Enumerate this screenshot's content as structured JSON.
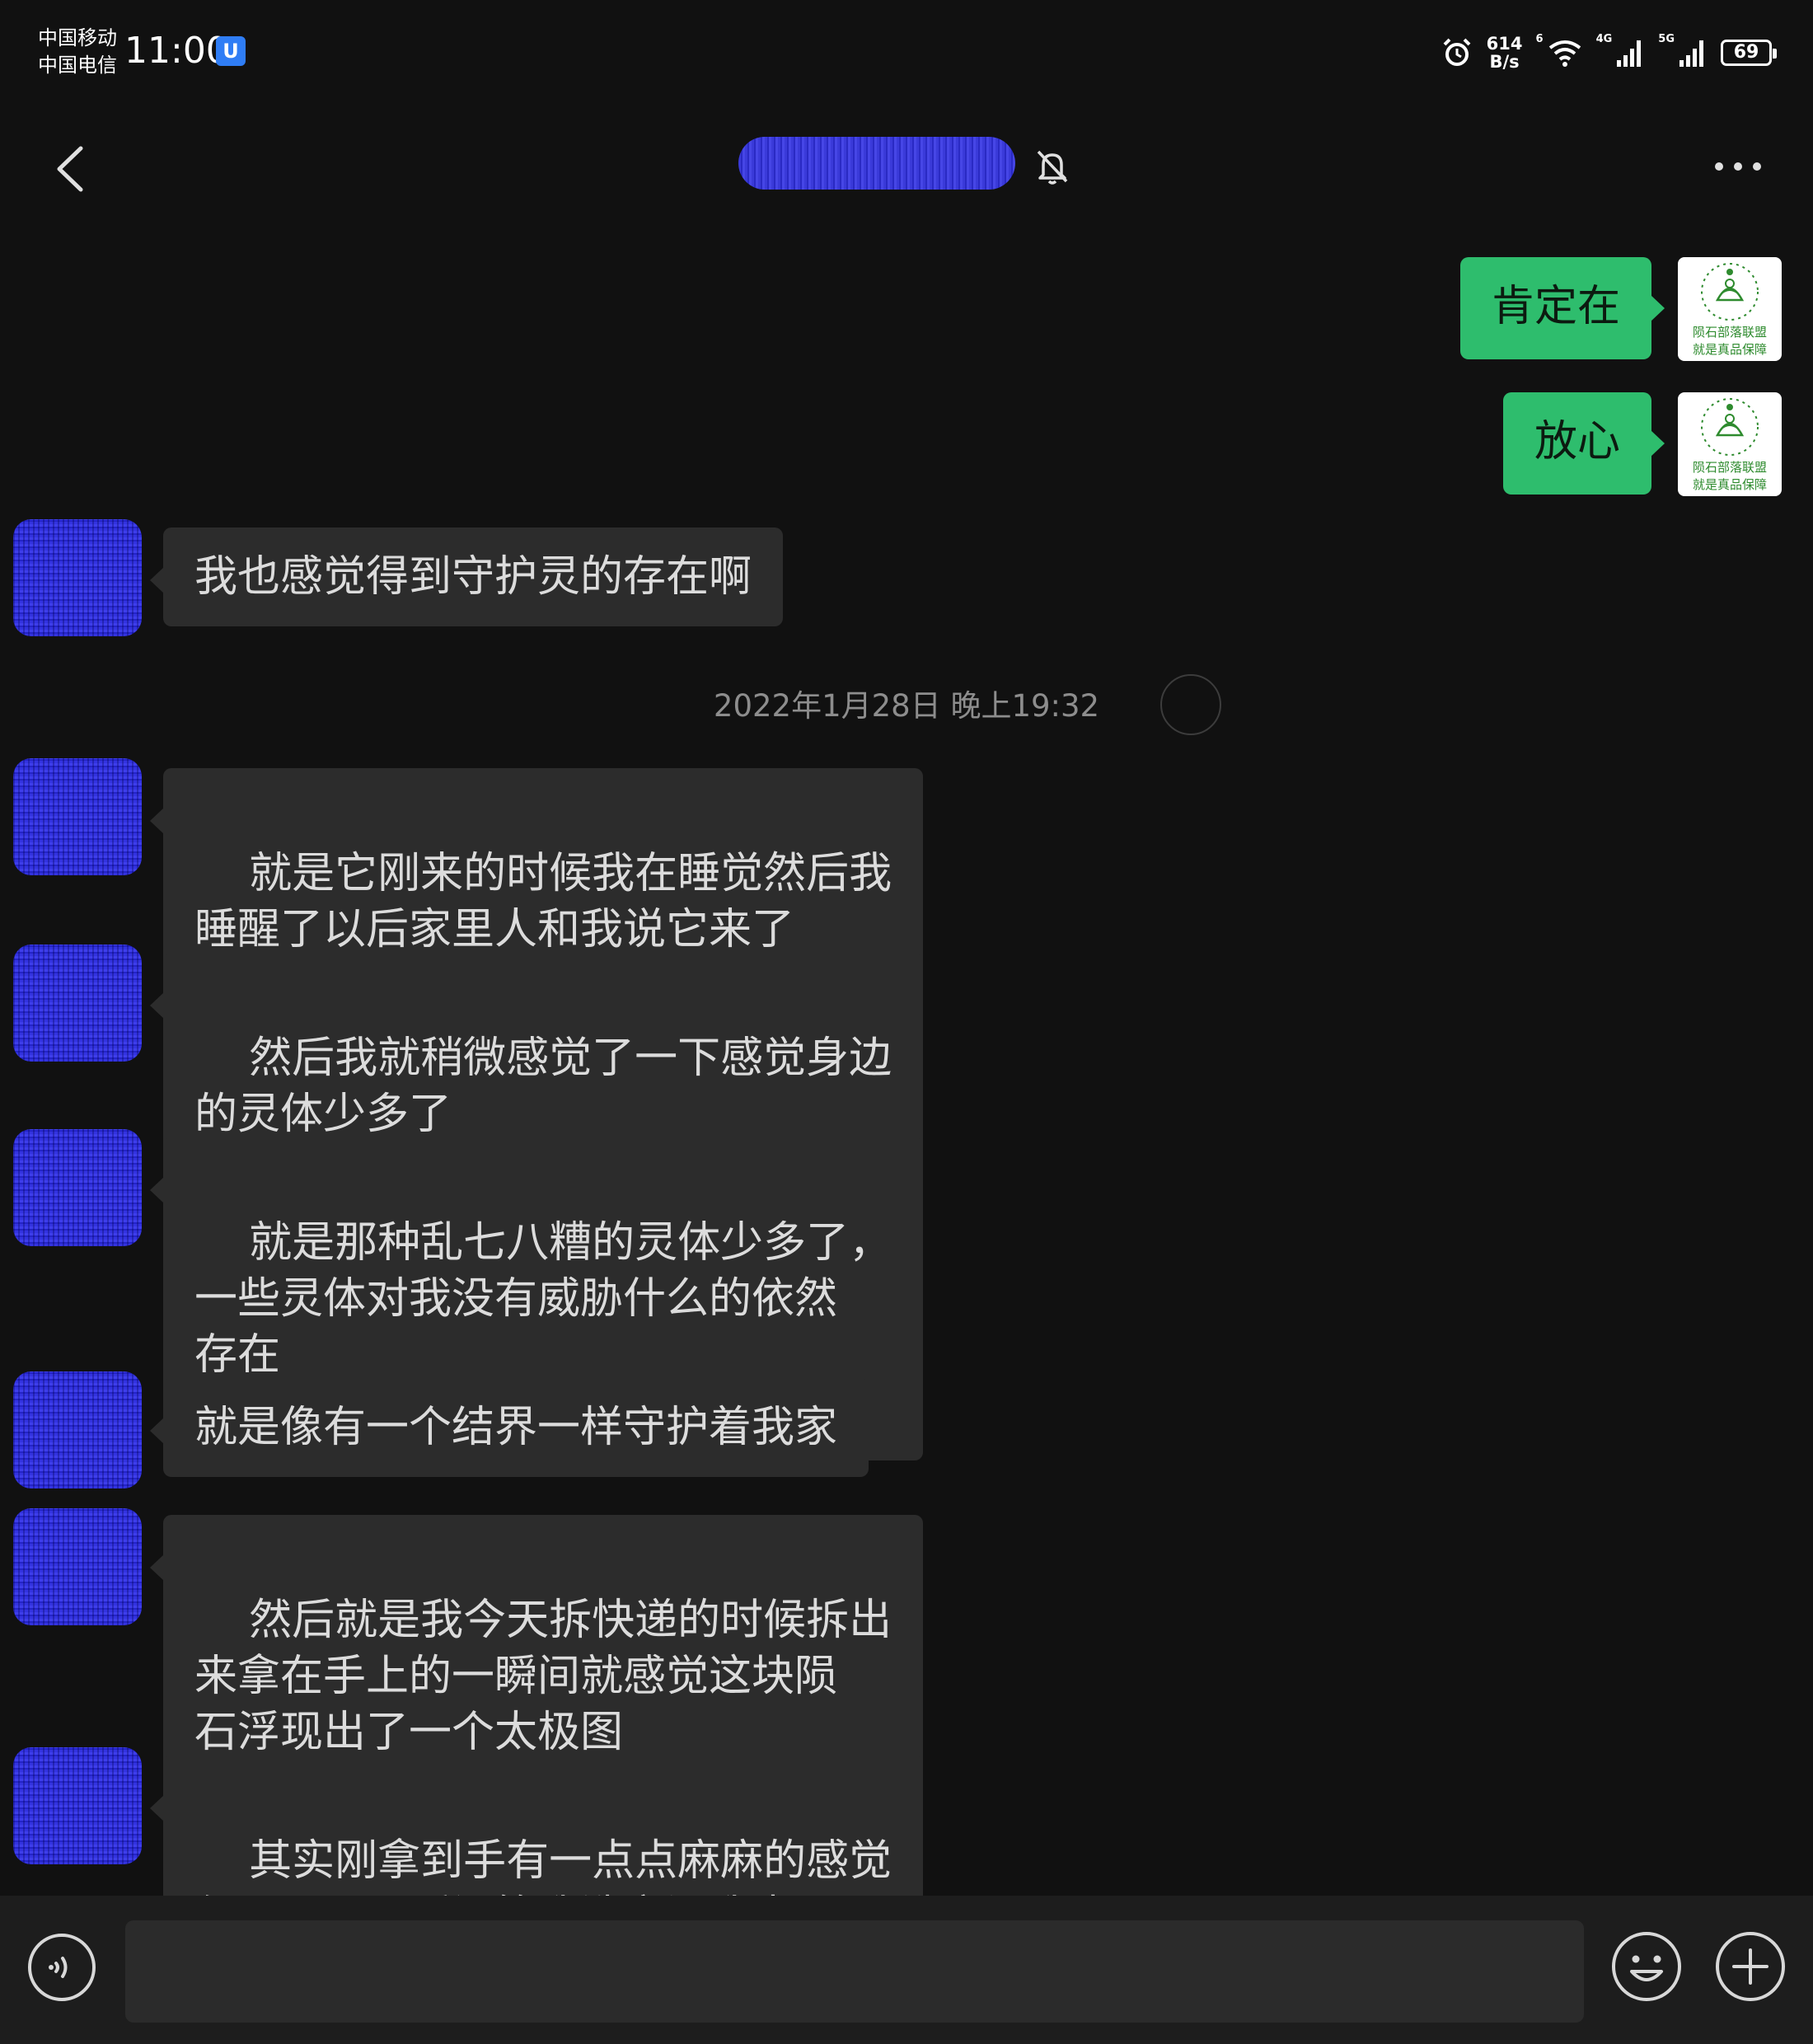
{
  "status_bar": {
    "carrier_1": "中国移动",
    "carrier_2": "中国电信",
    "time": "11:00",
    "app_badge": "U",
    "net_speed_value": "614",
    "net_speed_unit": "B/s",
    "wifi_tag": "6",
    "net_tag_1": "4G",
    "net_tag_2": "5G",
    "battery": "69"
  },
  "header": {
    "title": ""
  },
  "messages": [
    {
      "side": "me",
      "text": "肯定在"
    },
    {
      "side": "me",
      "text": "放心"
    },
    {
      "side": "other",
      "text": "我也感觉得到守护灵的存在啊"
    },
    {
      "type": "time",
      "text": "2022年1月28日 晚上19:32"
    },
    {
      "side": "other",
      "text": "就是它刚来的时候我在睡觉然后我\n睡醒了以后家里人和我说它来了"
    },
    {
      "side": "other",
      "text": "然后我就稍微感觉了一下感觉身边\n的灵体少多了"
    },
    {
      "side": "other",
      "text": "就是那种乱七八糟的灵体少多了，\n一些灵体对我没有威胁什么的依然\n存在"
    },
    {
      "side": "other",
      "text": "就是像有一个结界一样守护着我家"
    },
    {
      "side": "other",
      "text": "然后就是我今天拆快递的时候拆出\n来拿在手上的一瞬间就感觉这块陨\n石浮现出了一个太极图"
    },
    {
      "side": "other",
      "text": "其实刚拿到手有一点点麻麻的感觉\n但是只是一瞬间等我洗完澡我去具"
    }
  ],
  "my_avatar": {
    "logo_line_1": "陨石部落联盟",
    "logo_line_2": "就是真品保障",
    "logo_color": "#2e8b2e"
  },
  "input_bar": {
    "value": "",
    "placeholder": ""
  },
  "colors": {
    "background": "#111111",
    "my_bubble": "#2ebd6d",
    "other_bubble": "#2c2c2c",
    "input_bar": "#1d1d1d"
  }
}
